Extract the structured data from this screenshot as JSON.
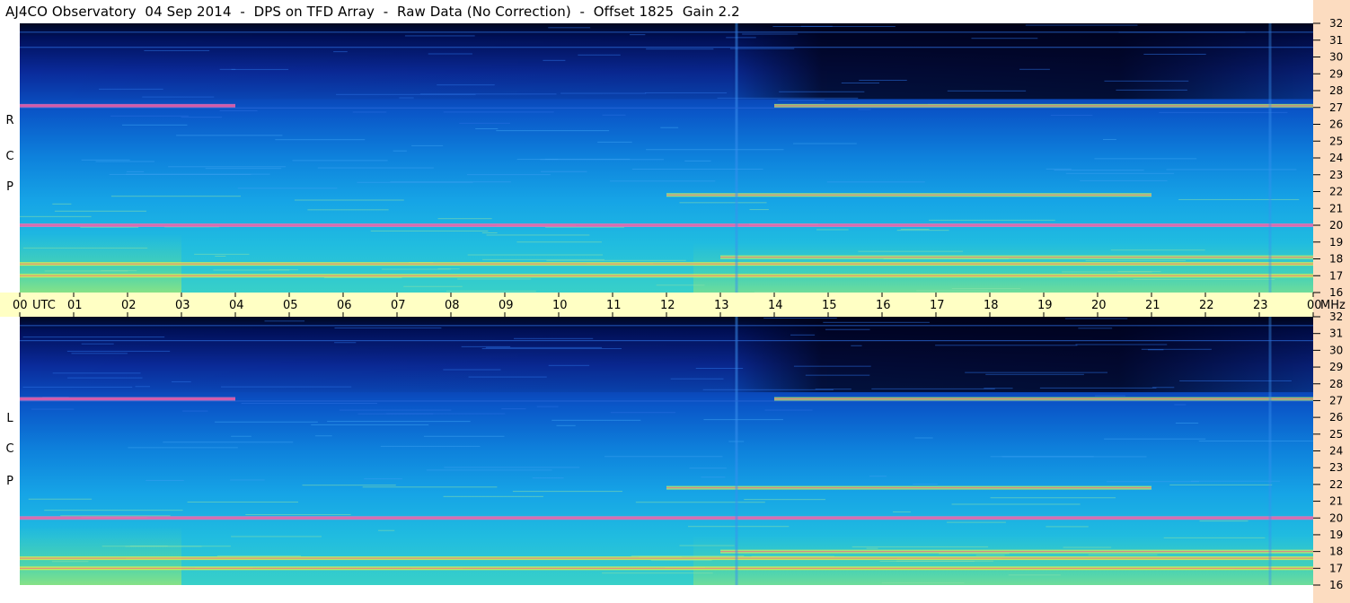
{
  "title": "AJ4CO Observatory  04 Sep 2014  -  DPS on TFD Array  -  Raw Data (No Correction)  -  Offset 1825  Gain 2.2",
  "panels": {
    "rcp_label": [
      "R",
      "C",
      "P"
    ],
    "lcp_label": [
      "L",
      "C",
      "P"
    ]
  },
  "colors": {
    "background": "#0a3fa8",
    "axis_time_bg": "#ffffc4",
    "axis_freq_bg": "#fcdcc0",
    "colormap": [
      "#000010",
      "#001060",
      "#0030b0",
      "#0078e0",
      "#1aa8e8",
      "#30c8d8",
      "#70e090",
      "#e0f040",
      "#ff60a0",
      "#c040ff"
    ]
  },
  "chart_data": [
    {
      "type": "heatmap",
      "name": "RCP",
      "x_unit": "UTC",
      "y_unit": "MHz",
      "xlim": [
        0,
        24
      ],
      "ylim": [
        16,
        32
      ],
      "x_ticks": [
        "00",
        "01",
        "02",
        "03",
        "04",
        "05",
        "06",
        "07",
        "08",
        "09",
        "10",
        "11",
        "12",
        "13",
        "14",
        "15",
        "16",
        "17",
        "18",
        "19",
        "20",
        "21",
        "22",
        "23",
        "00"
      ],
      "x_tick_labels_extra": [
        "UTC"
      ],
      "y_ticks": [
        "16",
        "17",
        "18",
        "19",
        "20",
        "21",
        "22",
        "23",
        "24",
        "25",
        "26",
        "27",
        "28",
        "29",
        "30",
        "31",
        "32"
      ],
      "y_unit_label": "MHz",
      "features": [
        {
          "kind": "band",
          "freq_mhz": 17.0,
          "start_utc": 0,
          "end_utc": 24,
          "intensity": 0.85
        },
        {
          "kind": "band",
          "freq_mhz": 17.7,
          "start_utc": 0,
          "end_utc": 24,
          "intensity": 0.9
        },
        {
          "kind": "band",
          "freq_mhz": 18.1,
          "start_utc": 13,
          "end_utc": 24,
          "intensity": 0.7
        },
        {
          "kind": "band",
          "freq_mhz": 20.0,
          "start_utc": 0,
          "end_utc": 24,
          "intensity": 0.6
        },
        {
          "kind": "band",
          "freq_mhz": 21.8,
          "start_utc": 12,
          "end_utc": 21,
          "intensity": 0.75
        },
        {
          "kind": "band",
          "freq_mhz": 27.1,
          "start_utc": 0,
          "end_utc": 4,
          "intensity": 0.6
        },
        {
          "kind": "band",
          "freq_mhz": 27.1,
          "start_utc": 14,
          "end_utc": 24,
          "intensity": 0.7
        },
        {
          "kind": "vertical",
          "time_utc": 13.3,
          "intensity": 0.5
        },
        {
          "kind": "vertical",
          "time_utc": 23.2,
          "intensity": 0.4
        }
      ]
    },
    {
      "type": "heatmap",
      "name": "LCP",
      "x_unit": "UTC",
      "y_unit": "MHz",
      "xlim": [
        0,
        24
      ],
      "ylim": [
        16,
        32
      ],
      "y_ticks": [
        "16",
        "17",
        "18",
        "19",
        "20",
        "21",
        "22",
        "23",
        "24",
        "25",
        "26",
        "27",
        "28",
        "29",
        "30",
        "31",
        "32"
      ],
      "features": [
        {
          "kind": "band",
          "freq_mhz": 17.0,
          "start_utc": 0,
          "end_utc": 24,
          "intensity": 0.85
        },
        {
          "kind": "band",
          "freq_mhz": 17.6,
          "start_utc": 0,
          "end_utc": 24,
          "intensity": 0.9
        },
        {
          "kind": "band",
          "freq_mhz": 18.0,
          "start_utc": 13,
          "end_utc": 24,
          "intensity": 0.7
        },
        {
          "kind": "band",
          "freq_mhz": 20.0,
          "start_utc": 0,
          "end_utc": 24,
          "intensity": 0.6
        },
        {
          "kind": "band",
          "freq_mhz": 21.8,
          "start_utc": 12,
          "end_utc": 21,
          "intensity": 0.75
        },
        {
          "kind": "band",
          "freq_mhz": 27.1,
          "start_utc": 0,
          "end_utc": 4,
          "intensity": 0.6
        },
        {
          "kind": "band",
          "freq_mhz": 27.1,
          "start_utc": 14,
          "end_utc": 24,
          "intensity": 0.7
        },
        {
          "kind": "vertical",
          "time_utc": 13.3,
          "intensity": 0.5
        },
        {
          "kind": "vertical",
          "time_utc": 23.2,
          "intensity": 0.4
        }
      ]
    }
  ]
}
